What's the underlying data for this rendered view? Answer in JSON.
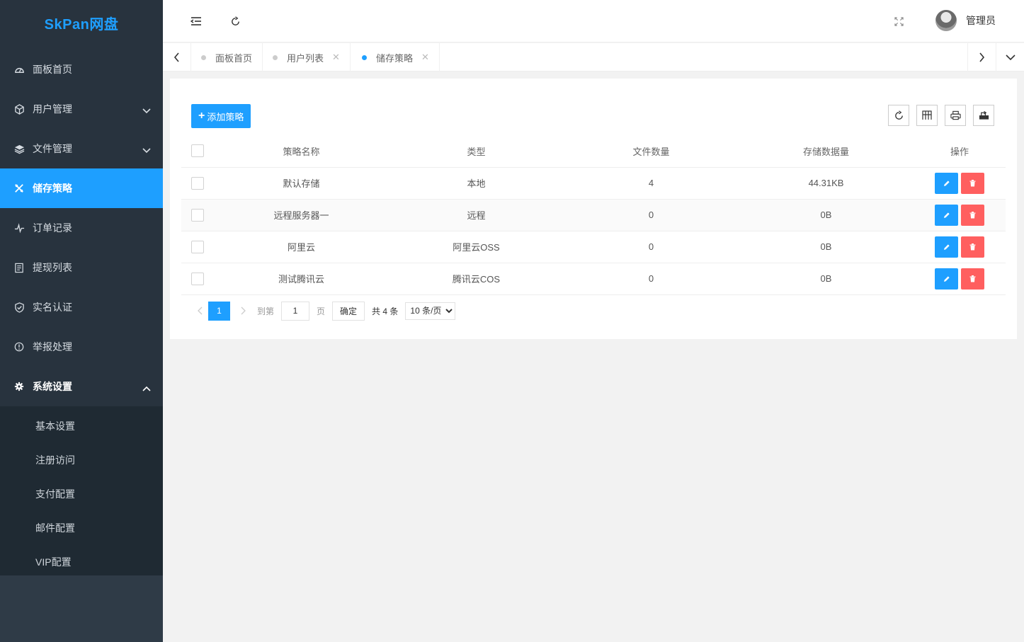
{
  "app": {
    "logo": "SkPan网盘"
  },
  "sidebar": {
    "items": [
      {
        "label": "面板首页",
        "icon": "dashboard-icon"
      },
      {
        "label": "用户管理",
        "icon": "cube-icon"
      },
      {
        "label": "文件管理",
        "icon": "layers-icon"
      },
      {
        "label": "储存策略",
        "icon": "strategy-icon"
      },
      {
        "label": "订单记录",
        "icon": "pulse-icon"
      },
      {
        "label": "提现列表",
        "icon": "list-icon"
      },
      {
        "label": "实名认证",
        "icon": "verify-icon"
      },
      {
        "label": "举报处理",
        "icon": "info-icon"
      },
      {
        "label": "系统设置",
        "icon": "gear-icon"
      }
    ],
    "submenu": [
      "基本设置",
      "注册访问",
      "支付配置",
      "邮件配置",
      "VIP配置"
    ]
  },
  "header": {
    "user_name": "管理员"
  },
  "tabs": [
    {
      "label": "面板首页"
    },
    {
      "label": "用户列表"
    },
    {
      "label": "储存策略"
    }
  ],
  "toolbar": {
    "add_label": "添加策略"
  },
  "table": {
    "columns": [
      "策略名称",
      "类型",
      "文件数量",
      "存储数据量",
      "操作"
    ],
    "rows": [
      {
        "name": "默认存储",
        "type": "本地",
        "count": "4",
        "size": "44.31KB"
      },
      {
        "name": "远程服务器一",
        "type": "远程",
        "count": "0",
        "size": "0B"
      },
      {
        "name": "阿里云",
        "type": "阿里云OSS",
        "count": "0",
        "size": "0B"
      },
      {
        "name": "测试腾讯云",
        "type": "腾讯云COS",
        "count": "0",
        "size": "0B"
      }
    ]
  },
  "pager": {
    "current": "1",
    "goto_label": "到第",
    "goto_value": "1",
    "page_unit": "页",
    "confirm": "确定",
    "total": "共 4 条",
    "per_page": "10 条/页"
  },
  "colors": {
    "primary": "#1e9fff",
    "danger": "#ff5f5f",
    "sidebar": "#28333e"
  }
}
